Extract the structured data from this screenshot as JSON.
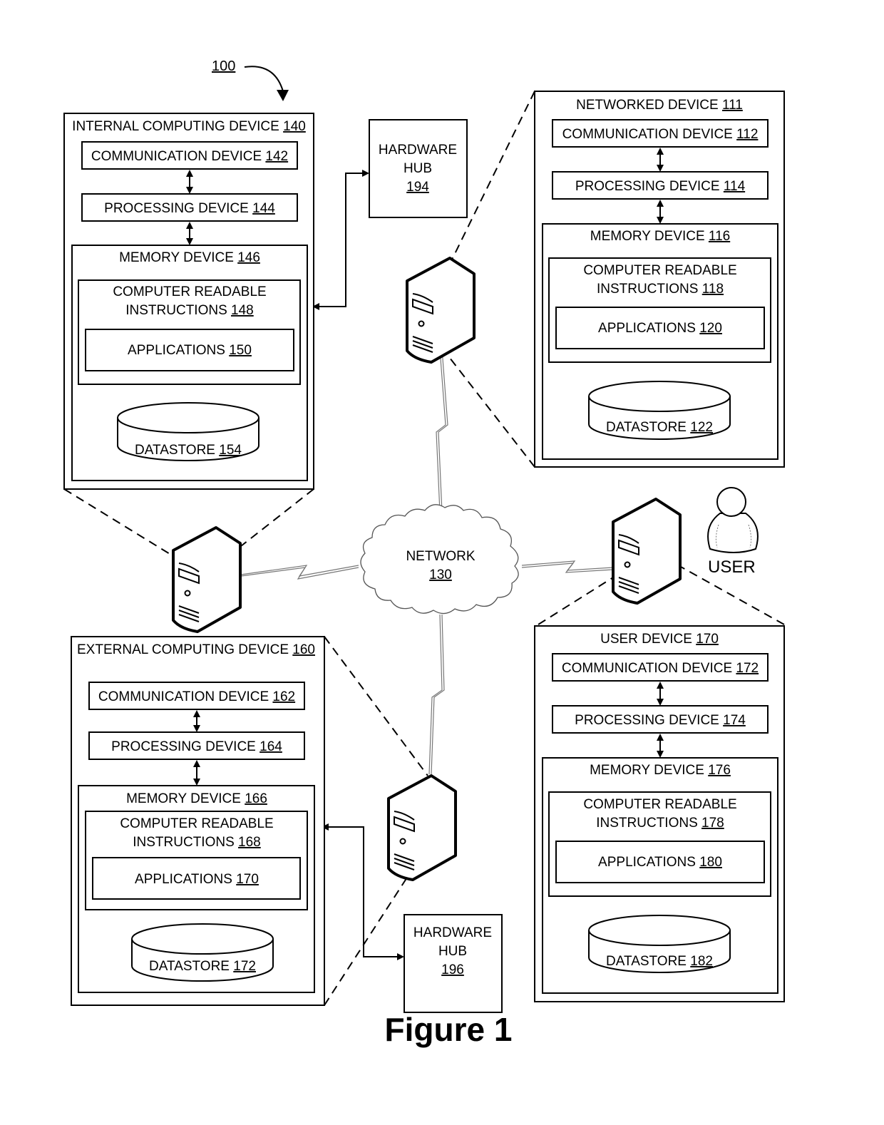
{
  "figure": {
    "title": "Figure 1",
    "system_ref": "100"
  },
  "network": {
    "label": "NETWORK",
    "ref": "130"
  },
  "user": {
    "label": "USER"
  },
  "hardware_hubs": [
    {
      "label_line1": "HARDWARE",
      "label_line2": "HUB",
      "ref": "194"
    },
    {
      "label_line1": "HARDWARE",
      "label_line2": "HUB",
      "ref": "196"
    }
  ],
  "devices": {
    "internal": {
      "title": "INTERNAL COMPUTING DEVICE",
      "ref": "140",
      "communication": {
        "label": "COMMUNICATION DEVICE",
        "ref": "142"
      },
      "processing": {
        "label": "PROCESSING DEVICE",
        "ref": "144"
      },
      "memory": {
        "label": "MEMORY DEVICE",
        "ref": "146"
      },
      "instructions": {
        "line1": "COMPUTER READABLE",
        "line2": "INSTRUCTIONS",
        "ref": "148"
      },
      "applications": {
        "label": "APPLICATIONS",
        "ref": "150"
      },
      "datastore": {
        "label": "DATASTORE",
        "ref": "154"
      }
    },
    "networked": {
      "title": "NETWORKED DEVICE",
      "ref": "111",
      "communication": {
        "label": "COMMUNICATION DEVICE",
        "ref": "112"
      },
      "processing": {
        "label": "PROCESSING DEVICE",
        "ref": "114"
      },
      "memory": {
        "label": "MEMORY DEVICE",
        "ref": "116"
      },
      "instructions": {
        "line1": "COMPUTER READABLE",
        "line2": "INSTRUCTIONS",
        "ref": "118"
      },
      "applications": {
        "label": "APPLICATIONS",
        "ref": "120"
      },
      "datastore": {
        "label": "DATASTORE",
        "ref": "122"
      }
    },
    "external": {
      "title": "EXTERNAL COMPUTING DEVICE",
      "ref": "160",
      "communication": {
        "label": "COMMUNICATION DEVICE",
        "ref": "162"
      },
      "processing": {
        "label": "PROCESSING DEVICE",
        "ref": "164"
      },
      "memory": {
        "label": "MEMORY DEVICE",
        "ref": "166"
      },
      "instructions": {
        "line1": "COMPUTER READABLE",
        "line2": "INSTRUCTIONS",
        "ref": "168"
      },
      "applications": {
        "label": "APPLICATIONS",
        "ref": "170"
      },
      "datastore": {
        "label": "DATASTORE",
        "ref": "172"
      }
    },
    "user_device": {
      "title": "USER DEVICE ",
      "ref": "170",
      "communication": {
        "label": "COMMUNICATION DEVICE",
        "ref": "172"
      },
      "processing": {
        "label": "PROCESSING DEVICE",
        "ref": "174"
      },
      "memory": {
        "label": "MEMORY DEVICE",
        "ref": "176"
      },
      "instructions": {
        "line1": "COMPUTER READABLE",
        "line2": "INSTRUCTIONS",
        "ref": "178"
      },
      "applications": {
        "label": "APPLICATIONS",
        "ref": "180"
      },
      "datastore": {
        "label": "DATASTORE",
        "ref": "182"
      }
    }
  }
}
